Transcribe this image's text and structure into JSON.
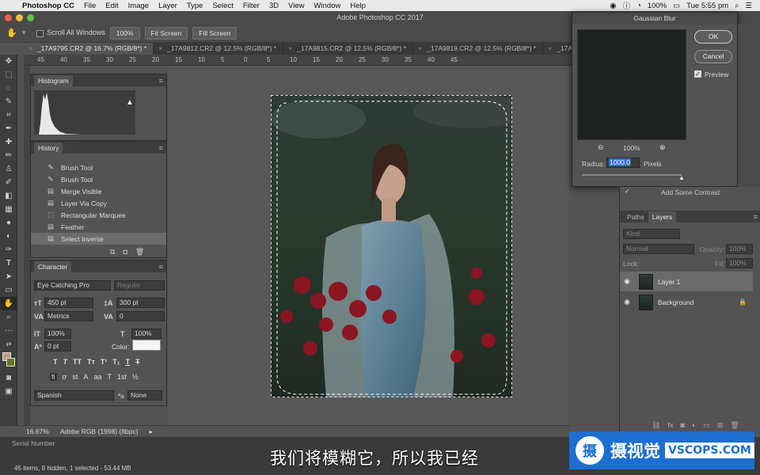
{
  "menubar": {
    "app": "Photoshop CC",
    "items": [
      "File",
      "Edit",
      "Image",
      "Layer",
      "Type",
      "Select",
      "Filter",
      "3D",
      "View",
      "Window",
      "Help"
    ],
    "battery": "100%",
    "clock": "Tue 5:55 pm"
  },
  "window_title": "Adobe Photoshop CC 2017",
  "options": {
    "scroll_all": "Scroll All Windows",
    "zoom_100": "100%",
    "fit_screen": "Fit Screen",
    "fill_screen": "Fill Screen"
  },
  "tabs": [
    "_17A9795.CR2 @ 16.7% (RGB/8*) *",
    "_17A9812.CR2 @ 12.5% (RGB/8*) *",
    "_17A9815.CR2 @ 12.5% (RGB/8*) *",
    "_17A9819.CR2 @ 12.5% (RGB/8*) *",
    "_17A9"
  ],
  "ruler_labels": [
    "45",
    "40",
    "35",
    "30",
    "25",
    "20",
    "15",
    "10",
    "5",
    "0",
    "5",
    "10",
    "15",
    "20",
    "25",
    "30",
    "35",
    "40",
    "45"
  ],
  "histogram": {
    "title": "Histogram"
  },
  "history": {
    "title": "History",
    "items": [
      {
        "icon": "brush",
        "label": "Brush Tool"
      },
      {
        "icon": "brush",
        "label": "Brush Tool"
      },
      {
        "icon": "doc",
        "label": "Merge Visible"
      },
      {
        "icon": "doc",
        "label": "Layer Via Copy"
      },
      {
        "icon": "marquee",
        "label": "Rectangular Marquee"
      },
      {
        "icon": "doc",
        "label": "Feather"
      },
      {
        "icon": "doc",
        "label": "Select Inverse"
      }
    ]
  },
  "character": {
    "title": "Character",
    "font": "Eye Catching Pro",
    "style": "Regular",
    "size": "450 pt",
    "leading": "300 pt",
    "kerning": "Metrics",
    "tracking": "0",
    "vscale": "100%",
    "hscale": "100%",
    "baseline": "0 pt",
    "color_label": "Color:",
    "language": "Spanish",
    "antialias": "None",
    "aa_label": "ªa"
  },
  "status": {
    "zoom": "16.67%",
    "profile": "Adobe RGB (1998) (8bpc)"
  },
  "dialog": {
    "title": "Gaussian Blur",
    "ok": "OK",
    "cancel": "Cancel",
    "preview": "Preview",
    "zoom": "100%",
    "radius_label": "Radius:",
    "radius": "1000.0",
    "unit": "Pixels"
  },
  "layers_panel": {
    "adjustment_hint": "Add Some Contrast",
    "tabs": [
      "Paths",
      "Layers"
    ],
    "kind": "Kind",
    "blend": "Normal",
    "opacity_label": "Opacity:",
    "opacity": "100%",
    "lock_label": "Lock:",
    "fill_label": "Fill:",
    "fill": "100%",
    "layers": [
      "Layer 1",
      "Background"
    ]
  },
  "filmstrip": {
    "serial_number": "Serial Number",
    "count": "45 items, 8 hidden, 1 selected - 53.44 MB"
  },
  "subtitle": "我们将模糊它，所以我已经",
  "watermark": {
    "glyph": "摄",
    "name_cn": "摄视觉",
    "name_en": "VSCOPS.COM"
  }
}
